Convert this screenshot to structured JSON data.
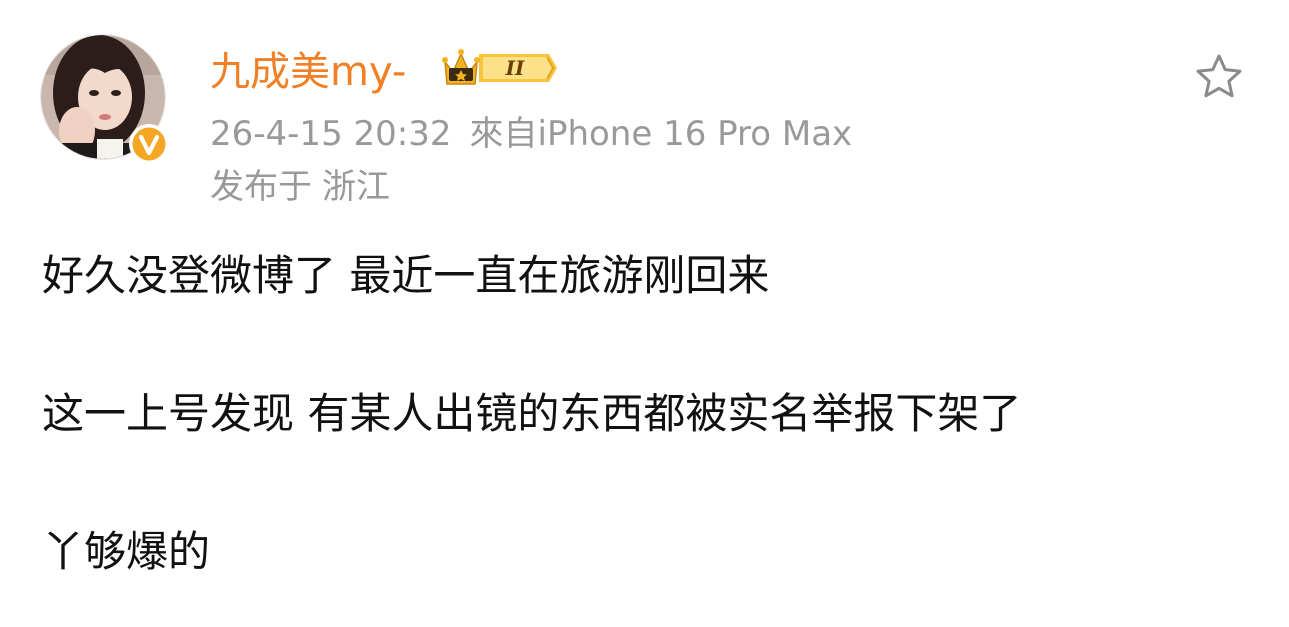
{
  "post": {
    "author": {
      "name": "九成美my-",
      "avatar_icon": "user-avatar-photo",
      "verified_icon": "verified-v-badge-icon",
      "level_badge_icon": "crown-level-badge-icon",
      "level_badge_text": "II"
    },
    "timestamp": "26-4-15 20:32",
    "source": "來自iPhone 16 Pro Max",
    "location_label": "发布于",
    "location": "浙江",
    "favorite_icon": "star-outline-icon",
    "content_lines": [
      "好久没登微博了 最近一直在旅游刚回来",
      "这一上号发现 有某人出镜的东西都被实名举报下架了",
      "丫够爆的"
    ]
  },
  "colors": {
    "username": "#f07f25",
    "meta_text": "#999999",
    "body_text": "#111111",
    "verified_badge": "#f5a623",
    "crown_gold": "#f5b324"
  }
}
